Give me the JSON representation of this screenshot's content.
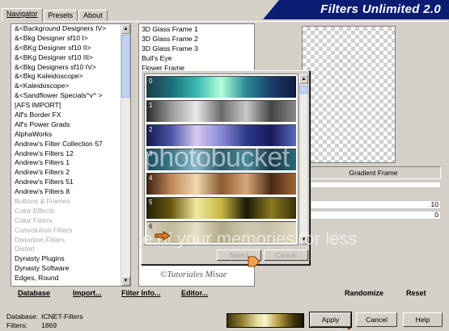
{
  "header": {
    "tabs": [
      "Navigator",
      "Presets",
      "About"
    ],
    "title": "Filters Unlimited 2.0"
  },
  "categories": [
    {
      "label": "&<Background Designers IV>",
      "disabled": false
    },
    {
      "label": "&<Bkg Designer sf10 I>",
      "disabled": false
    },
    {
      "label": "&<BKg Designer sf10 II>",
      "disabled": false
    },
    {
      "label": "&<BKg Designer sf10 III>",
      "disabled": false
    },
    {
      "label": "&<Bkg Designers sf10 IV>",
      "disabled": false
    },
    {
      "label": "&<Bkg Kaleidoscope>",
      "disabled": false
    },
    {
      "label": "&<Kaleidoscope>",
      "disabled": false
    },
    {
      "label": "&<Sandflower Specials^v^ >",
      "disabled": false
    },
    {
      "label": "[AFS IMPORT]",
      "disabled": false
    },
    {
      "label": "Alf's Border FX",
      "disabled": false
    },
    {
      "label": "Alf's Power Grads",
      "disabled": false
    },
    {
      "label": "AlphaWorks",
      "disabled": false
    },
    {
      "label": "Andrew's Filter Collection 57",
      "disabled": false
    },
    {
      "label": "Andrew's Filters 12",
      "disabled": false
    },
    {
      "label": "Andrew's Filters 1",
      "disabled": false
    },
    {
      "label": "Andrew's Filters 2",
      "disabled": false
    },
    {
      "label": "Andrew's Filters 51",
      "disabled": false
    },
    {
      "label": "Andrew's Filters 8",
      "disabled": false
    },
    {
      "label": "Buttons & Frames",
      "disabled": true
    },
    {
      "label": "Color Effects",
      "disabled": true
    },
    {
      "label": "Color Filters",
      "disabled": true
    },
    {
      "label": "Convolution Filters",
      "disabled": true
    },
    {
      "label": "Distortion Filters",
      "disabled": true
    },
    {
      "label": "Distort",
      "disabled": true
    },
    {
      "label": "Dynasty Plugins",
      "disabled": false
    },
    {
      "label": "Dynasty Software",
      "disabled": false
    },
    {
      "label": "Edges, Round",
      "disabled": false
    }
  ],
  "filters": [
    "3D Glass Frame 1",
    "3D Glass Frame 2",
    "3D Glass Frame 3",
    "Bull's Eye",
    "Flower Frame"
  ],
  "right": {
    "filter_name": "Gradient Frame",
    "param1": "10",
    "param2": "0"
  },
  "popup": {
    "gradients": [
      {
        "index": "0",
        "stops": [
          "#1f3e48",
          "#1e6d78",
          "#38b8b0",
          "#b0ffd8",
          "#2c8a98",
          "#1b3f6a",
          "#111a3e"
        ]
      },
      {
        "index": "1",
        "stops": [
          "#2a2a2a",
          "#9a9a9a",
          "#e8e8e8",
          "#6a6a6a",
          "#c8c8c8",
          "#444444",
          "#8a8a8a"
        ]
      },
      {
        "index": "2",
        "stops": [
          "#141a4a",
          "#4a56a8",
          "#d8c8f0",
          "#8a8ad8",
          "#2e3a8a",
          "#1a1a5a",
          "#5a6ac0"
        ]
      },
      {
        "index": "3",
        "stops": [
          "#1c4a5a",
          "#3a7a8a",
          "#8ab8c8",
          "#2a5a6a",
          "#4a8a9a",
          "#1a3a4a",
          "#2a6a7a"
        ]
      },
      {
        "index": "4",
        "stops": [
          "#3a2010",
          "#c08858",
          "#f0d8b0",
          "#8a5a30",
          "#d8a878",
          "#4a2a14",
          "#a06838"
        ]
      },
      {
        "index": "5",
        "stops": [
          "#202008",
          "#6a5a10",
          "#f0e8a0",
          "#c8b840",
          "#1a1808",
          "#8a7a20",
          "#3a3008"
        ]
      },
      {
        "index": "6",
        "stops": [
          "#d8d0c0",
          "#c0b898",
          "#e8e0c8",
          "#b0a888",
          "#d0c8b0",
          "#c8c0a8",
          "#e0d8c0"
        ]
      }
    ],
    "select_label": "Select",
    "cancel_label": "Cancel"
  },
  "watermark": {
    "big": "photobucket",
    "mid": "e of your memories for less",
    "small": "©Tutoriales Misae"
  },
  "bottom": {
    "database_label": "Database",
    "import_label": "Import...",
    "filter_info_label": "Filter Info...",
    "editor_label": "Editor...",
    "randomize_label": "Randomize",
    "reset_label": "Reset"
  },
  "status": {
    "database_key": "Database:",
    "database_value": "ICNET-Filters",
    "filters_key": "Filters:",
    "filters_value": "1869"
  },
  "buttons": {
    "apply": "Apply",
    "cancel": "Cancel",
    "help": "Help"
  }
}
